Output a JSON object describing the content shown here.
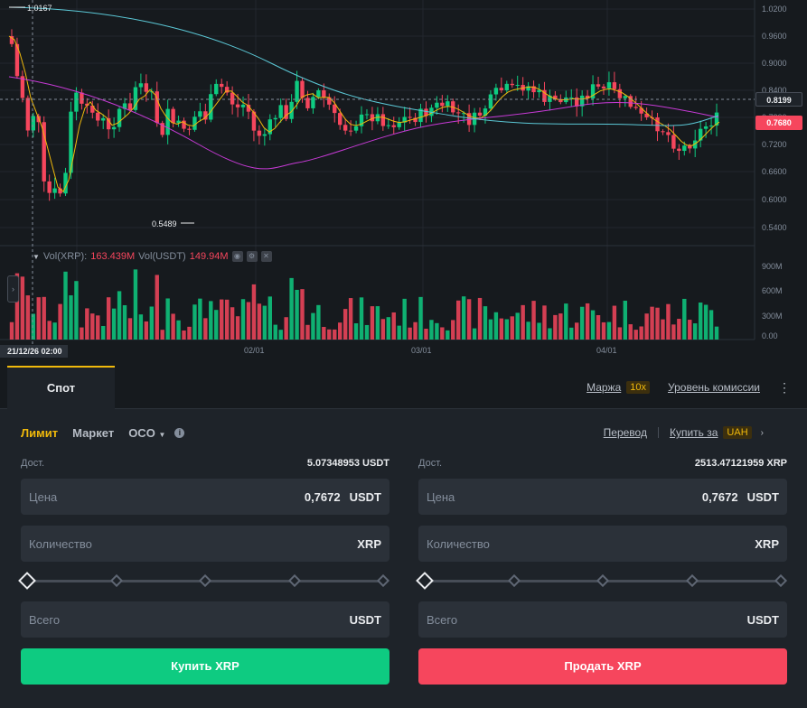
{
  "chart": {
    "price_axis": [
      "1.0200",
      "0.9600",
      "0.9000",
      "0.8400",
      "0.7800",
      "0.7200",
      "0.6600",
      "0.6000",
      "0.5400"
    ],
    "volume_axis": [
      "900M",
      "600M",
      "300M",
      "0.00"
    ],
    "time_axis": [
      "02/01",
      "03/01",
      "04/01"
    ],
    "crosshair_time": "21/12/26 02:00",
    "last_price_tag": "0.8199",
    "current_price_tag": "0.7680",
    "high_marker": "1.0167",
    "low_marker": "0.5489",
    "colors": {
      "up": "#0ecb81",
      "down": "#f6465d",
      "ma_fast": "#f0b90b",
      "ma_mid": "#c73ad6",
      "ma_slow": "#5bc8d6"
    }
  },
  "volume_legend": {
    "xrp_label": "Vol(XRP):",
    "xrp_value": "163.439M",
    "usdt_label": "Vol(USDT)",
    "usdt_value": "149.94M"
  },
  "tabs": {
    "spot": "Спот",
    "margin": "Маржа",
    "margin_badge": "10x",
    "fee_level": "Уровень комиссии"
  },
  "order_types": {
    "limit": "Лимит",
    "market": "Маркет",
    "oco": "OCO",
    "transfer": "Перевод",
    "buy_with": "Купить за",
    "currency_badge": "UAH"
  },
  "buy": {
    "avail_label": "Дост.",
    "avail_value": "5.07348953 USDT",
    "price_label": "Цена",
    "price_value": "0,7672",
    "price_unit": "USDT",
    "qty_label": "Количество",
    "qty_unit": "XRP",
    "total_label": "Всего",
    "total_unit": "USDT",
    "button": "Купить XRP"
  },
  "sell": {
    "avail_label": "Дост.",
    "avail_value": "2513.47121959 XRP",
    "price_label": "Цена",
    "price_value": "0,7672",
    "price_unit": "USDT",
    "qty_label": "Количество",
    "qty_unit": "XRP",
    "total_label": "Всего",
    "total_unit": "USDT",
    "button": "Продать XRP"
  }
}
